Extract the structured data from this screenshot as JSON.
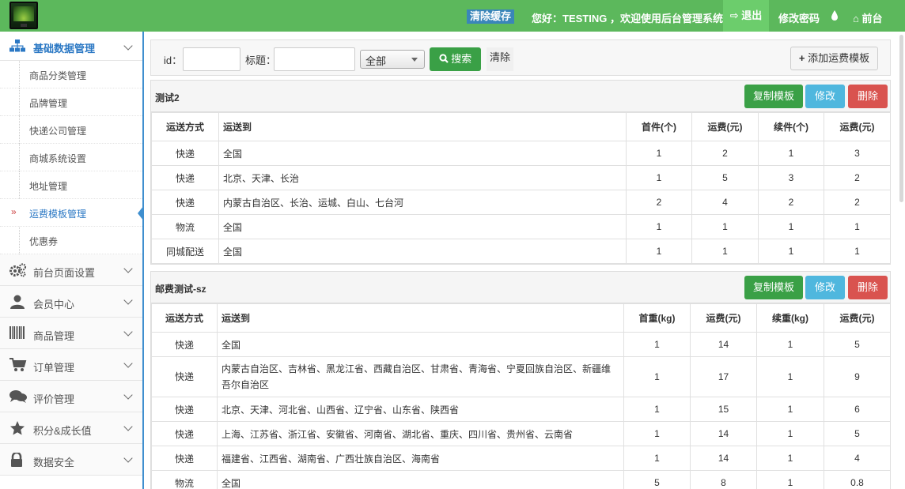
{
  "header": {
    "clear_cache": "清除缓存",
    "welcome": "您好：TESTING ，欢迎使用后台管理系统！",
    "logout": "退出",
    "change_password": "修改密码",
    "frontend": "前台"
  },
  "sidebar": {
    "section_title": "基础数据管理",
    "sub_items": [
      {
        "label": "商品分类管理"
      },
      {
        "label": "品牌管理"
      },
      {
        "label": "快递公司管理"
      },
      {
        "label": "商城系统设置"
      },
      {
        "label": "地址管理"
      },
      {
        "label": "运费模板管理"
      },
      {
        "label": "优惠券"
      }
    ],
    "groups": [
      {
        "label": "前台页面设置",
        "icon": "gears-icon"
      },
      {
        "label": "会员中心",
        "icon": "user-icon"
      },
      {
        "label": "商品管理",
        "icon": "barcode-icon"
      },
      {
        "label": "订单管理",
        "icon": "cart-icon"
      },
      {
        "label": "评价管理",
        "icon": "comments-icon"
      },
      {
        "label": "积分&成长值",
        "icon": "star-icon"
      },
      {
        "label": "数据安全",
        "icon": "lock-icon"
      }
    ]
  },
  "search": {
    "id_label": "id：",
    "title_label": "标题：",
    "select_value": "全部",
    "search_button": "搜索",
    "clear_button": "清除",
    "add_button": "添加运费模板"
  },
  "card_buttons": {
    "copy": "复制模板",
    "edit": "修改",
    "delete": "删除"
  },
  "templates": [
    {
      "name": "测试2",
      "headers": [
        "运送方式",
        "运送到",
        "首件(个)",
        "运费(元)",
        "续件(个)",
        "运费(元)"
      ],
      "rows": [
        [
          "快递",
          "全国",
          "1",
          "2",
          "1",
          "3"
        ],
        [
          "快递",
          "北京、天津、长治",
          "1",
          "5",
          "3",
          "2"
        ],
        [
          "快递",
          "内蒙古自治区、长治、运城、白山、七台河",
          "2",
          "4",
          "2",
          "2"
        ],
        [
          "物流",
          "全国",
          "1",
          "1",
          "1",
          "1"
        ],
        [
          "同城配送",
          "全国",
          "1",
          "1",
          "1",
          "1"
        ]
      ]
    },
    {
      "name": "邮费测试-sz",
      "headers": [
        "运送方式",
        "运送到",
        "首重(kg)",
        "运费(元)",
        "续重(kg)",
        "运费(元)"
      ],
      "rows": [
        [
          "快递",
          "全国",
          "1",
          "14",
          "1",
          "5"
        ],
        [
          "快递",
          "内蒙古自治区、吉林省、黑龙江省、西藏自治区、甘肃省、青海省、宁夏回族自治区、新疆维吾尔自治区",
          "1",
          "17",
          "1",
          "9"
        ],
        [
          "快递",
          "北京、天津、河北省、山西省、辽宁省、山东省、陕西省",
          "1",
          "15",
          "1",
          "6"
        ],
        [
          "快递",
          "上海、江苏省、浙江省、安徽省、河南省、湖北省、重庆、四川省、贵州省、云南省",
          "1",
          "14",
          "1",
          "5"
        ],
        [
          "快递",
          "福建省、江西省、湖南省、广西壮族自治区、海南省",
          "1",
          "14",
          "1",
          "4"
        ],
        [
          "物流",
          "全国",
          "5",
          "8",
          "1",
          "0.8"
        ]
      ]
    }
  ]
}
